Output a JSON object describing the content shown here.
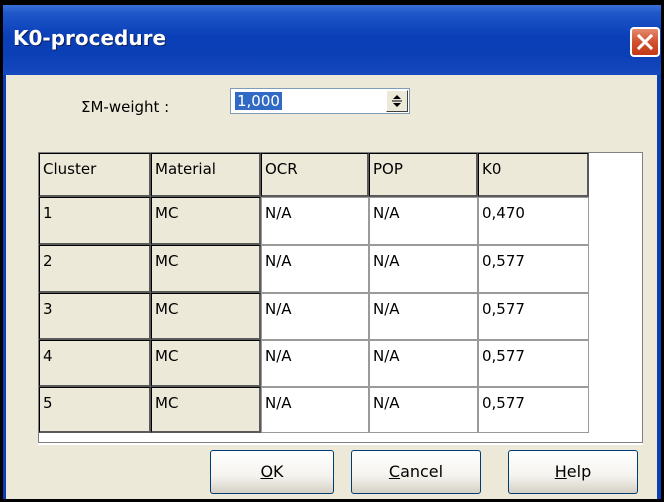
{
  "window": {
    "title": "K0-procedure"
  },
  "weight": {
    "label": "ΣM-weight :",
    "value": "1,000"
  },
  "table": {
    "headers": [
      "Cluster",
      "Material",
      "OCR",
      "POP",
      "K0"
    ],
    "rows": [
      [
        "1",
        "MC",
        "N/A",
        "N/A",
        "0,470"
      ],
      [
        "2",
        "MC",
        "N/A",
        "N/A",
        "0,577"
      ],
      [
        "3",
        "MC",
        "N/A",
        "N/A",
        "0,577"
      ],
      [
        "4",
        "MC",
        "N/A",
        "N/A",
        "0,577"
      ],
      [
        "5",
        "MC",
        "N/A",
        "N/A",
        "0,577"
      ]
    ]
  },
  "buttons": {
    "ok": {
      "mnemonic": "O",
      "rest": "K"
    },
    "cancel": {
      "mnemonic": "C",
      "rest": "ancel"
    },
    "help": {
      "mnemonic": "H",
      "rest": "elp"
    }
  },
  "colors": {
    "titlebar": "#0B3FB5",
    "selection": "#316AC5",
    "close": "#C23A17"
  },
  "icons": {
    "close": "close-icon",
    "spin": "spin-arrows-icon"
  }
}
